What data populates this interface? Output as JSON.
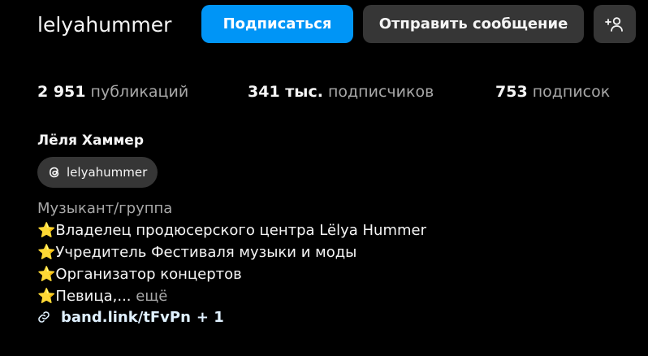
{
  "profile": {
    "username": "lelyahummer",
    "full_name": "Лёля Хаммер",
    "threads_handle": "lelyahummer"
  },
  "actions": {
    "follow_label": "Подписаться",
    "message_label": "Отправить сообщение",
    "add_user_icon": "add-user-icon"
  },
  "stats": {
    "posts_count": "2 951",
    "posts_label": "публикаций",
    "followers_count": "341 тыс.",
    "followers_label": "подписчиков",
    "following_count": "753",
    "following_label": "подписок"
  },
  "bio": {
    "category": "Музыкант/группа",
    "lines": [
      "Владелец продюсерского центра Lëlya Hummer",
      "Учредитель Фестиваля музыки и моды",
      "Организатор концертов",
      "Певица,..."
    ],
    "star": "⭐",
    "more_label": "ещё"
  },
  "link": {
    "text": "band.link/tFvPn",
    "extra": "+ 1"
  },
  "colors": {
    "background": "#000000",
    "primary_button": "#0095f6",
    "secondary_button": "#363636",
    "muted_text": "#a8a8a8",
    "link_text": "#e0f1ff"
  }
}
